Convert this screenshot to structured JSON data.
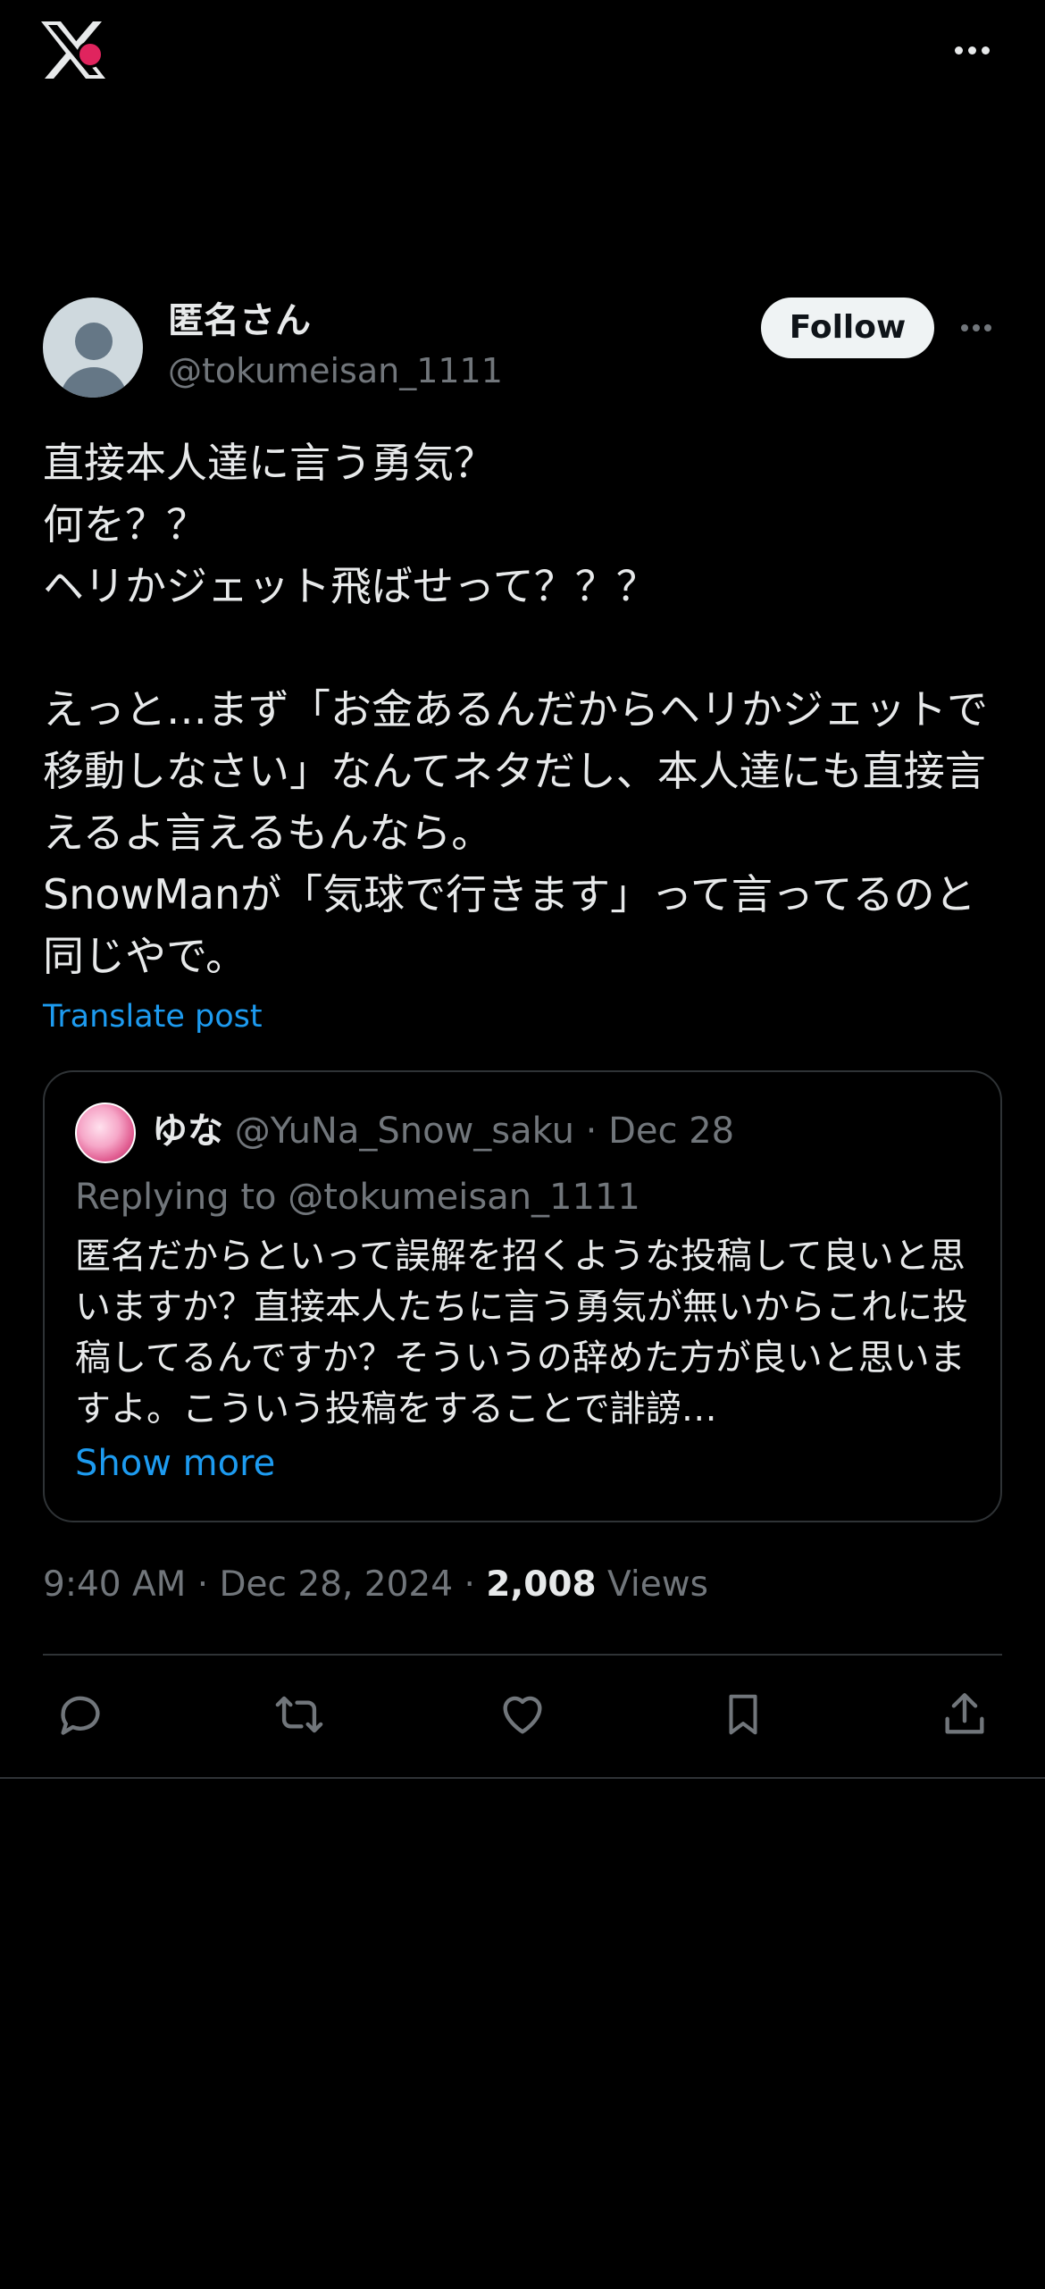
{
  "topbar": {
    "logo_icon": "x-logo-icon",
    "menu_icon": "more-horizontal-icon"
  },
  "author": {
    "display_name": "匿名さん",
    "handle": "@tokumeisan_1111",
    "follow_label": "Follow",
    "menu_icon": "more-horizontal-icon"
  },
  "tweet": {
    "text": "直接本人達に言う勇気？\n何を？？\nヘリかジェット飛ばせって？？？\n\nえっと…まず「お金あるんだからヘリかジェットで移動しなさい」なんてネタだし、本人達にも直接言えるよ言えるもんなら。\nSnowManが「気球で行きます」って言ってるのと同じやで。",
    "translate_label": "Translate post"
  },
  "quote": {
    "name": "ゆな",
    "handle": "@YuNa_Snow_saku",
    "separator": " · ",
    "date": "Dec 28",
    "replying": "Replying to @tokumeisan_1111",
    "body": "匿名だからといって誤解を招くような投稿して良いと思いますか？直接本人たちに言う勇気が無いからこれに投稿してるんですか？そういうの辞めた方が良いと思いますよ。こういう投稿をすることで誹謗…",
    "show_more": "Show more"
  },
  "meta": {
    "time": "9:40 AM",
    "sep1": " · ",
    "date": "Dec 28, 2024",
    "sep2": " · ",
    "views_count": "2,008",
    "views_label": " Views"
  },
  "actions": [
    "reply-icon",
    "retweet-icon",
    "like-icon",
    "bookmark-icon",
    "share-icon"
  ],
  "colors": {
    "background": "#000000",
    "text": "#e7e9ea",
    "muted": "#71767b",
    "accent": "#1d9bf0",
    "border": "#2f3336"
  }
}
